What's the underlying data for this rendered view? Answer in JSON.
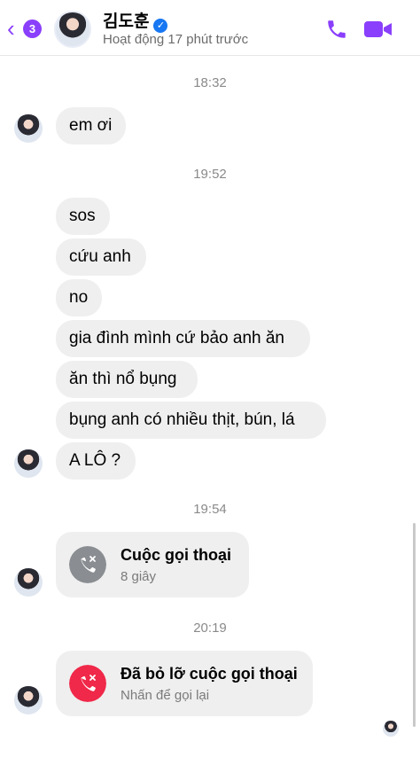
{
  "header": {
    "back_badge": "3",
    "contact_name": "김도훈",
    "status": "Hoạt động 17 phút trước",
    "accent_color": "#8a3ffc"
  },
  "timestamps": [
    "18:32",
    "19:52",
    "19:54",
    "20:19"
  ],
  "messages": {
    "group1": [
      "em ơi"
    ],
    "group2": [
      "sos",
      "cứu anh",
      "no",
      "gia đình mình cứ bảo anh ăn",
      "ăn thì nổ bụng",
      "bụng anh có nhiều thịt, bún, lá",
      "A LÔ ?"
    ]
  },
  "calls": {
    "voice_call": {
      "title": "Cuộc gọi thoại",
      "subtitle": "8 giây",
      "icon": "missed-outgoing-call-icon",
      "color": "#8a8d91"
    },
    "missed_call": {
      "title": "Đã bỏ lỡ cuộc gọi thoại",
      "subtitle": "Nhấn để gọi lại",
      "icon": "missed-call-icon",
      "color": "#f02849"
    }
  }
}
